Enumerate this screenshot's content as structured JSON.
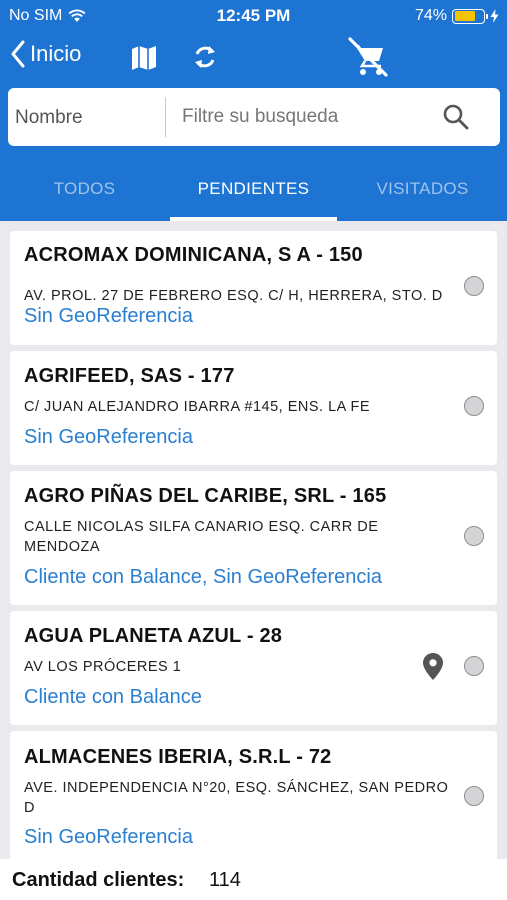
{
  "status_bar": {
    "carrier": "No SIM",
    "time": "12:45 PM",
    "battery_percent": "74%",
    "battery_level": 0.74,
    "icons": [
      "wifi-icon",
      "battery-icon",
      "charging-bolt-icon"
    ]
  },
  "navbar": {
    "back_label": "Inicio",
    "icons": [
      "chevron-left-icon",
      "map-icon",
      "sync-icon",
      "cart-off-icon"
    ]
  },
  "search": {
    "name_label": "Nombre",
    "filter_placeholder": "Filtre su busqueda",
    "filter_value": "",
    "icon": "search-icon"
  },
  "tabs": [
    {
      "label": "TODOS",
      "active": false
    },
    {
      "label": "PENDIENTES",
      "active": true
    },
    {
      "label": "VISITADOS",
      "active": false
    }
  ],
  "clients": [
    {
      "title": "ACROMAX DOMINICANA, S A - 150",
      "address": "AV. PROL. 27 DE FEBRERO ESQ. C/ H, HERRERA, STO. D",
      "status": "Sin GeoReferencia",
      "has_location": false
    },
    {
      "title": "AGRIFEED, SAS - 177",
      "address": "C/ JUAN ALEJANDRO IBARRA #145, ENS. LA FE",
      "status": "Sin GeoReferencia",
      "has_location": false
    },
    {
      "title": "AGRO PIÑAS DEL CARIBE, SRL - 165",
      "address": "CALLE NICOLAS SILFA CANARIO ESQ. CARR DE MENDOZA",
      "status": "Cliente con Balance, Sin GeoReferencia",
      "has_location": false
    },
    {
      "title": "AGUA PLANETA AZUL - 28",
      "address": "AV LOS PRÓCERES 1",
      "status": "Cliente con Balance",
      "has_location": true
    },
    {
      "title": "ALMACENES IBERIA, S.R.L - 72",
      "address": "AVE. INDEPENDENCIA N°20, ESQ. SÁNCHEZ, SAN PEDRO D",
      "status": "Sin GeoReferencia",
      "has_location": false
    }
  ],
  "footer": {
    "count_label": "Cantidad clientes:",
    "count_value": "114"
  },
  "colors": {
    "primary": "#1d74d2",
    "link": "#2a7fd0",
    "battery": "#f5c400"
  }
}
